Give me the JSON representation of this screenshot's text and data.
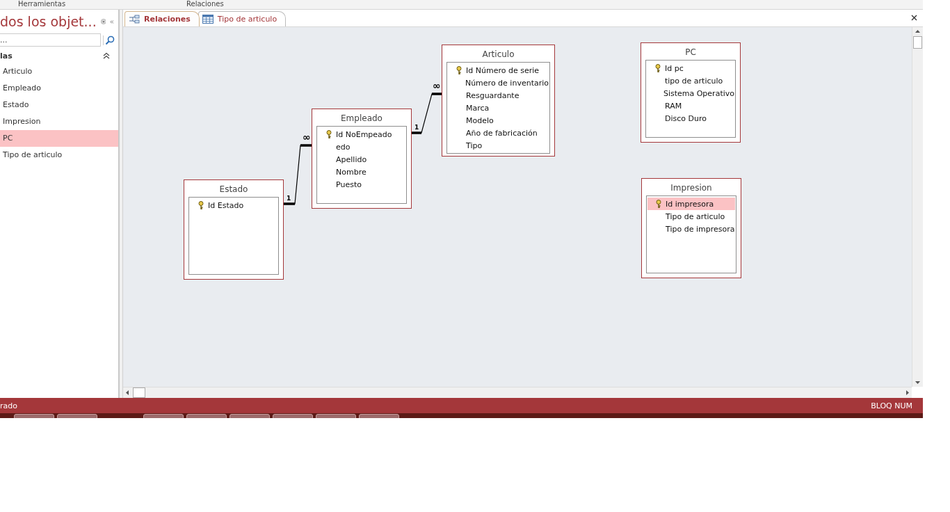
{
  "ribbon_tabs": [
    "Herramientas",
    "Relaciones"
  ],
  "navigation_pane": {
    "title": "dos los objet...",
    "search": {
      "placeholder": "..."
    },
    "group": {
      "label": "las",
      "expanded": true
    },
    "items": [
      {
        "label": "Articulo",
        "selected": false
      },
      {
        "label": "Empleado",
        "selected": false
      },
      {
        "label": "Estado",
        "selected": false
      },
      {
        "label": "Impresion",
        "selected": false
      },
      {
        "label": "PC",
        "selected": true
      },
      {
        "label": "Tipo de articulo",
        "selected": false
      }
    ]
  },
  "document_tabs": [
    {
      "label": "Relaciones",
      "kind": "relationships",
      "selected": true
    },
    {
      "label": "Tipo de articulo",
      "kind": "table",
      "selected": false
    }
  ],
  "tables": [
    {
      "name": "Estado",
      "fields": [
        {
          "name": "Id Estado",
          "primary_key": true,
          "selected": false
        }
      ]
    },
    {
      "name": "Empleado",
      "fields": [
        {
          "name": "Id NoEmpeado",
          "primary_key": true,
          "selected": false
        },
        {
          "name": "edo",
          "primary_key": false,
          "selected": false
        },
        {
          "name": "Apellido",
          "primary_key": false,
          "selected": false
        },
        {
          "name": "Nombre",
          "primary_key": false,
          "selected": false
        },
        {
          "name": "Puesto",
          "primary_key": false,
          "selected": false
        }
      ]
    },
    {
      "name": "Articulo",
      "fields": [
        {
          "name": "Id Número de serie",
          "primary_key": true,
          "selected": false
        },
        {
          "name": "Número de inventario",
          "primary_key": false,
          "selected": false
        },
        {
          "name": "Resguardante",
          "primary_key": false,
          "selected": false
        },
        {
          "name": "Marca",
          "primary_key": false,
          "selected": false
        },
        {
          "name": "Modelo",
          "primary_key": false,
          "selected": false
        },
        {
          "name": "Año de fabricación",
          "primary_key": false,
          "selected": false
        },
        {
          "name": "Tipo",
          "primary_key": false,
          "selected": false
        }
      ]
    },
    {
      "name": "PC",
      "fields": [
        {
          "name": "Id pc",
          "primary_key": true,
          "selected": false
        },
        {
          "name": "tipo de articulo",
          "primary_key": false,
          "selected": false
        },
        {
          "name": "Sistema Operativo",
          "primary_key": false,
          "selected": false
        },
        {
          "name": "RAM",
          "primary_key": false,
          "selected": false
        },
        {
          "name": "Disco Duro",
          "primary_key": false,
          "selected": false
        }
      ]
    },
    {
      "name": "Impresion",
      "fields": [
        {
          "name": "Id impresora",
          "primary_key": true,
          "selected": true
        },
        {
          "name": "Tipo de articulo",
          "primary_key": false,
          "selected": false
        },
        {
          "name": "Tipo de impresora",
          "primary_key": false,
          "selected": false
        }
      ]
    }
  ],
  "relationships": [
    {
      "one_label": "1",
      "many_label": "∞"
    },
    {
      "one_label": "1",
      "many_label": "∞"
    }
  ],
  "status_bar": {
    "left": "rado",
    "right": "BLOQ NUM"
  }
}
